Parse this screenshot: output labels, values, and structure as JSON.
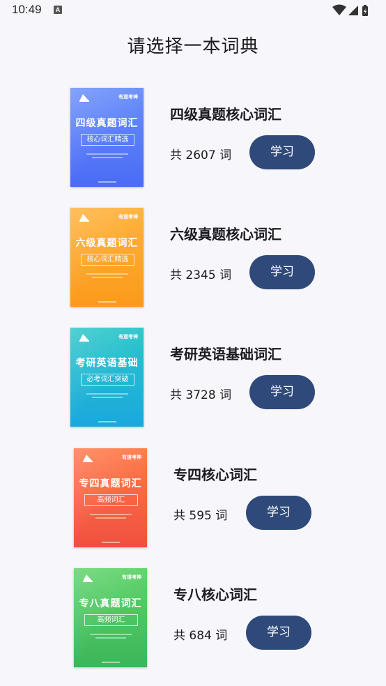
{
  "status_bar": {
    "time": "10:49",
    "notification_icon": "A"
  },
  "page": {
    "title": "请选择一本词典"
  },
  "dictionaries": [
    {
      "name": "四级真题核心词汇",
      "count_text": "共 2607 词",
      "button_label": "学习",
      "cover": {
        "title": "四级真题词汇",
        "subtitle": "核心词汇精选",
        "brand": "有道考神",
        "color_top": "#6a8ffb",
        "color_bottom": "#4a6bf5"
      }
    },
    {
      "name": "六级真题核心词汇",
      "count_text": "共 2345 词",
      "button_label": "学习",
      "cover": {
        "title": "六级真题词汇",
        "subtitle": "核心词汇精选",
        "brand": "有道考神",
        "color_top": "#ffb23c",
        "color_bottom": "#fb9a1c"
      }
    },
    {
      "name": "考研英语基础词汇",
      "count_text": "共 3728 词",
      "button_label": "学习",
      "cover": {
        "title": "考研英语基础",
        "subtitle": "必考词汇突破",
        "brand": "有道考神",
        "color_top": "#2cc6c8",
        "color_bottom": "#1aa8de"
      }
    },
    {
      "name": "专四核心词汇",
      "count_text": "共 595 词",
      "button_label": "学习",
      "cover": {
        "title": "专四真题词汇",
        "subtitle": "高频词汇",
        "brand": "有道考神",
        "color_top": "#ff7a4a",
        "color_bottom": "#f0503e"
      }
    },
    {
      "name": "专八核心词汇",
      "count_text": "共 684 词",
      "button_label": "学习",
      "cover": {
        "title": "专八真题词汇",
        "subtitle": "高频词汇",
        "brand": "有道考神",
        "color_top": "#5fd36a",
        "color_bottom": "#3cb65a"
      }
    }
  ],
  "colors": {
    "button": "#2f4a7a",
    "background": "#f7f6fb"
  }
}
